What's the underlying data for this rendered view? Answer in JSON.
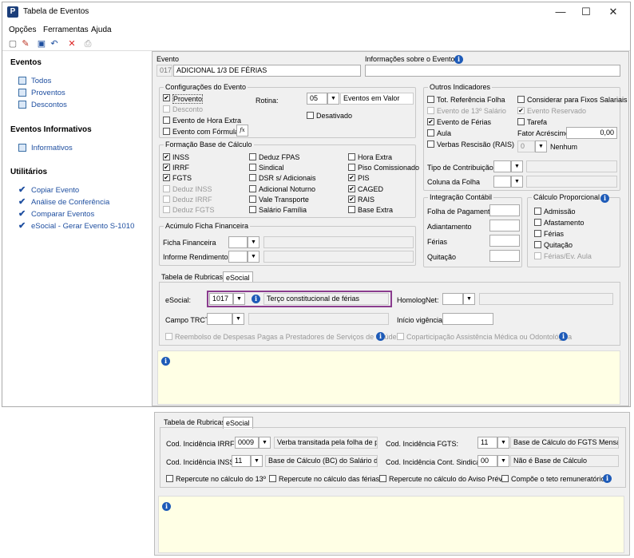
{
  "window": {
    "title": "Tabela de Eventos",
    "min": "—",
    "max": "☐",
    "close": "✕"
  },
  "menu": [
    "Opções",
    "Ferramentas",
    "Ajuda"
  ],
  "left": {
    "eventos_header": "Eventos",
    "eventos": [
      "Todos",
      "Proventos",
      "Descontos"
    ],
    "informativos_header": "Eventos Informativos",
    "informativos": [
      "Informativos"
    ],
    "utilitarios_header": "Utilitários",
    "utilitarios": [
      "Copiar Evento",
      "Análise de Conferência",
      "Comparar Eventos",
      "eSocial - Gerar Evento S-1010"
    ]
  },
  "evento": {
    "label": "Evento",
    "code": "017",
    "name": "ADICIONAL 1/3 DE FÉRIAS",
    "info_label": "Informações sobre o Evento"
  },
  "config": {
    "legend": "Configurações do Evento",
    "provento": "Provento",
    "desconto": "Desconto",
    "hora_extra": "Evento de Hora Extra",
    "formula": "Evento com Fórmula",
    "rotina_label": "Rotina:",
    "rotina_code": "05",
    "rotina_desc": "Eventos em Valor",
    "desativado": "Desativado"
  },
  "formacao": {
    "legend": "Formação Base de Cálculo",
    "col1": [
      {
        "l": "INSS",
        "c": true,
        "d": false
      },
      {
        "l": "IRRF",
        "c": true,
        "d": false
      },
      {
        "l": "FGTS",
        "c": true,
        "d": false
      },
      {
        "l": "Deduz INSS",
        "c": false,
        "d": true
      },
      {
        "l": "Deduz IRRF",
        "c": false,
        "d": true
      },
      {
        "l": "Deduz FGTS",
        "c": false,
        "d": true
      }
    ],
    "col2": [
      {
        "l": "Deduz FPAS",
        "c": false
      },
      {
        "l": "Sindical",
        "c": false
      },
      {
        "l": "DSR s/ Adicionais",
        "c": false
      },
      {
        "l": "Adicional Noturno",
        "c": false
      },
      {
        "l": "Vale Transporte",
        "c": false
      },
      {
        "l": "Salário Família",
        "c": false
      }
    ],
    "col3": [
      {
        "l": "Hora Extra",
        "c": false
      },
      {
        "l": "Piso Comissionado",
        "c": false
      },
      {
        "l": "PIS",
        "c": true
      },
      {
        "l": "CAGED",
        "c": true
      },
      {
        "l": "RAIS",
        "c": true
      },
      {
        "l": "Base Extra",
        "c": false
      }
    ]
  },
  "acumulo": {
    "legend": "Acúmulo Ficha Financeira",
    "ficha": "Ficha Financeira",
    "informe": "Informe Rendimentos"
  },
  "outros": {
    "legend": "Outros Indicadores",
    "tot": "Tot. Referência Folha",
    "decimo": "Evento de 13º Salário",
    "ferias": "Evento de Férias",
    "aula": "Aula",
    "verbas": "Verbas Rescisão (RAIS)",
    "fixos": "Considerar para Fixos Salariais",
    "reservado": "Evento Reservado",
    "tarefa": "Tarefa",
    "fator_label": "Fator Acréscimo",
    "fator": "0,00",
    "nenhum_code": "0",
    "nenhum": "Nenhum",
    "tipo_contrib": "Tipo de Contribuição",
    "coluna_folha": "Coluna da Folha"
  },
  "integracao": {
    "legend": "Integração Contábil",
    "items": [
      "Folha de Pagamento",
      "Adiantamento",
      "Férias",
      "Quitação"
    ]
  },
  "proporcional": {
    "legend": "Cálculo Proporcional",
    "items": [
      "Admissão",
      "Afastamento",
      "Férias",
      "Quitação",
      "Férias/Ev. Aula"
    ]
  },
  "tabs": {
    "rubricas": "Tabela de Rubricas",
    "esocial": "eSocial"
  },
  "esocial": {
    "label": "eSocial:",
    "code": "1017",
    "desc": "Terço constitucional de férias",
    "homolog": "HomologNet:",
    "trct": "Campo TRCT:",
    "vigencia": "Início vigência:",
    "reembolso": "Reembolso de Despesas Pagas a Prestadores de Serviços de Saúde",
    "copart": "Coparticipação Assistência Médica ou Odontológica"
  },
  "bottom": {
    "irrf_label": "Cod. Incidência IRRF:",
    "irrf_code": "0009",
    "irrf_desc": "Verba transitada pela folha de paga",
    "inss_label": "Cod. Incidência INSS:",
    "inss_code": "11",
    "inss_desc": "Base de Cálculo (BC) do Salário de Con",
    "fgts_label": "Cod. Incidência FGTS:",
    "fgts_code": "11",
    "fgts_desc": "Base de Cálculo do FGTS Mensal",
    "sind_label": "Cod. Incidência Cont. Sindical:",
    "sind_code": "00",
    "sind_desc": "Não é Base de Cálculo",
    "rep13": "Repercute no cálculo do 13º",
    "repfer": "Repercute no cálculo das férias",
    "repaviso": "Repercute no cálculo do Aviso Prévio",
    "teto": "Compõe o teto remuneratório"
  }
}
